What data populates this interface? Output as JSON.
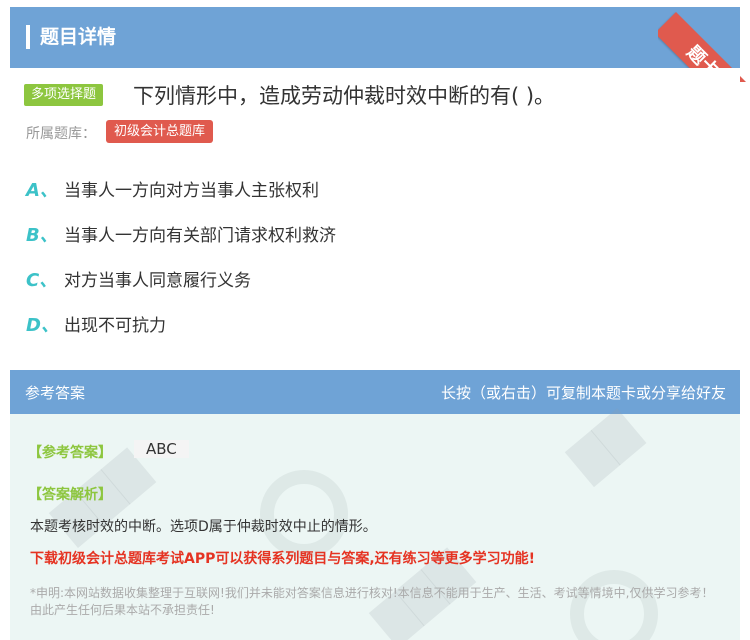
{
  "header": {
    "title": "题目详情",
    "ribbon": "题卡"
  },
  "question": {
    "type_badge": "多项选择题",
    "text": "下列情形中，造成劳动仲裁时效中断的有( )。",
    "bank_label": "所属题库：",
    "bank_name": "初级会计总题库"
  },
  "options": [
    {
      "letter": "A、",
      "text": "当事人一方向对方当事人主张权利"
    },
    {
      "letter": "B、",
      "text": "当事人一方向有关部门请求权利救济"
    },
    {
      "letter": "C、",
      "text": "对方当事人同意履行义务"
    },
    {
      "letter": "D、",
      "text": "出现不可抗力"
    }
  ],
  "answer": {
    "header_left": "参考答案",
    "header_right": "长按（或右击）可复制本题卡或分享给好友",
    "answer_label": "【参考答案】",
    "answer_value": "ABC",
    "analysis_label": "【答案解析】",
    "analysis_text": "本题考核时效的中断。选项D属于仲裁时效中止的情形。",
    "promo": "下载初级会计总题库考试APP可以获得系列题目与答案,还有练习等更多学习功能!",
    "disclaimer": "*申明:本网站数据收集整理于互联网!我们并未能对答案信息进行核对!本信息不能用于生产、生活、考试等情境中,仅供学习参考！由此产生任何后果本站不承担责任!"
  },
  "colors": {
    "header": "#6fa3d6",
    "green": "#8dc63f",
    "red": "#e05a4e",
    "teal": "#3cc2c8"
  }
}
